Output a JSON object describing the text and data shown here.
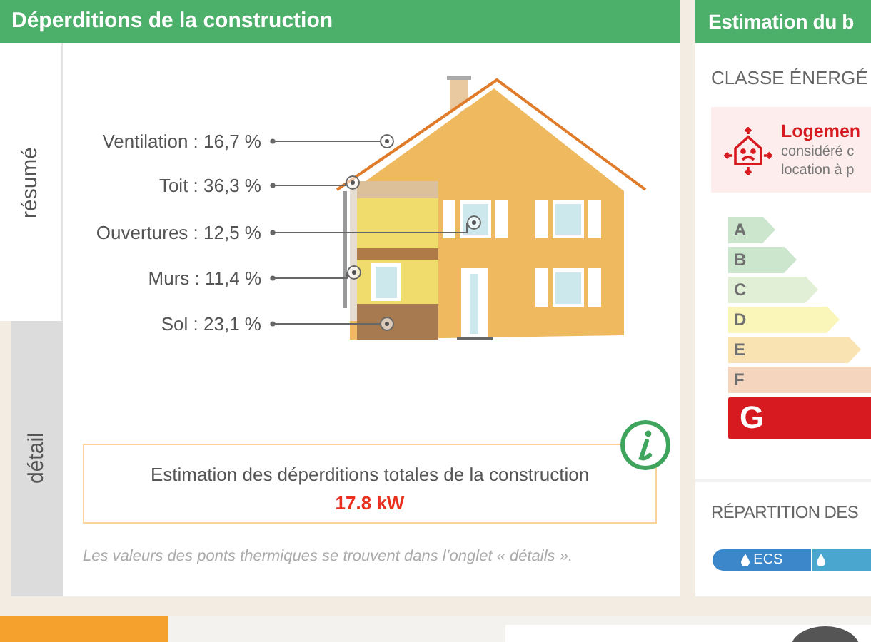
{
  "left_panel": {
    "title": "Déperditions de la construction",
    "tabs": [
      {
        "label": "résumé",
        "selected": true
      },
      {
        "label": "détail",
        "selected": false
      }
    ],
    "diagram_labels": [
      {
        "label": "Ventilation : 16,7 %"
      },
      {
        "label": "Toit : 36,3 %"
      },
      {
        "label": "Ouvertures : 12,5 %"
      },
      {
        "label": "Murs : 11,4 %"
      },
      {
        "label": "Sol : 23,1 %"
      }
    ],
    "total": {
      "label": "Estimation des déperditions totales de la construction",
      "value": "17.8 kW"
    },
    "note": "Les valeurs des ponts thermiques se trouvent dans l’onglet « détails »."
  },
  "right_panel": {
    "title": "Estimation du b",
    "energy_class_heading": "CLASSE ÉNERGÉ",
    "alert": {
      "title": "Logemen",
      "lines": [
        "considéré c",
        "location à p"
      ]
    },
    "energy_classes": [
      {
        "letter": "A",
        "color": "#cbe6cc",
        "selected": false
      },
      {
        "letter": "B",
        "color": "#cbe6cc",
        "selected": false
      },
      {
        "letter": "C",
        "color": "#e0efd5",
        "selected": false
      },
      {
        "letter": "D",
        "color": "#faf5b9",
        "selected": false
      },
      {
        "letter": "E",
        "color": "#f9e3b3",
        "selected": false
      },
      {
        "letter": "F",
        "color": "#f6d5bf",
        "selected": false
      },
      {
        "letter": "G",
        "color": "#d71a1f",
        "selected": true
      }
    ],
    "distribution_heading": "RÉPARTITION DES",
    "distribution": [
      {
        "label": "ECS",
        "color": "#3b87c9"
      },
      {
        "color": "#4aa6cf"
      }
    ]
  }
}
